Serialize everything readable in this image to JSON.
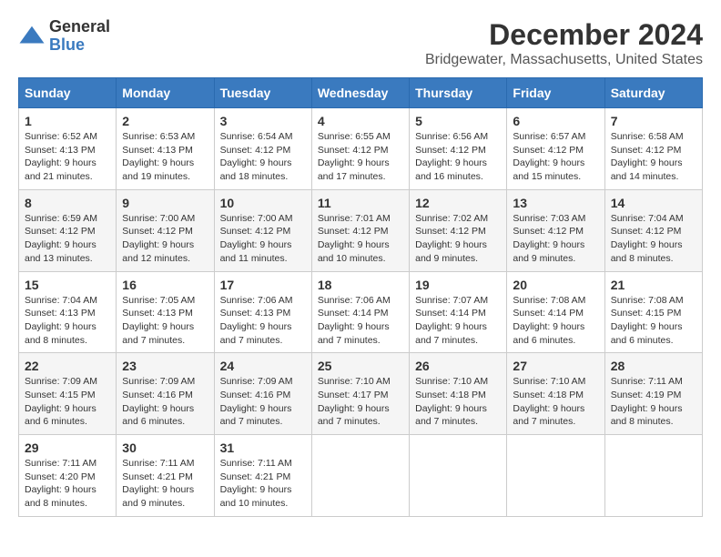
{
  "logo": {
    "general": "General",
    "blue": "Blue"
  },
  "title": "December 2024",
  "subtitle": "Bridgewater, Massachusetts, United States",
  "weekdays": [
    "Sunday",
    "Monday",
    "Tuesday",
    "Wednesday",
    "Thursday",
    "Friday",
    "Saturday"
  ],
  "weeks": [
    [
      {
        "day": "1",
        "sunrise": "6:52 AM",
        "sunset": "4:13 PM",
        "daylight": "9 hours and 21 minutes."
      },
      {
        "day": "2",
        "sunrise": "6:53 AM",
        "sunset": "4:13 PM",
        "daylight": "9 hours and 19 minutes."
      },
      {
        "day": "3",
        "sunrise": "6:54 AM",
        "sunset": "4:12 PM",
        "daylight": "9 hours and 18 minutes."
      },
      {
        "day": "4",
        "sunrise": "6:55 AM",
        "sunset": "4:12 PM",
        "daylight": "9 hours and 17 minutes."
      },
      {
        "day": "5",
        "sunrise": "6:56 AM",
        "sunset": "4:12 PM",
        "daylight": "9 hours and 16 minutes."
      },
      {
        "day": "6",
        "sunrise": "6:57 AM",
        "sunset": "4:12 PM",
        "daylight": "9 hours and 15 minutes."
      },
      {
        "day": "7",
        "sunrise": "6:58 AM",
        "sunset": "4:12 PM",
        "daylight": "9 hours and 14 minutes."
      }
    ],
    [
      {
        "day": "8",
        "sunrise": "6:59 AM",
        "sunset": "4:12 PM",
        "daylight": "9 hours and 13 minutes."
      },
      {
        "day": "9",
        "sunrise": "7:00 AM",
        "sunset": "4:12 PM",
        "daylight": "9 hours and 12 minutes."
      },
      {
        "day": "10",
        "sunrise": "7:00 AM",
        "sunset": "4:12 PM",
        "daylight": "9 hours and 11 minutes."
      },
      {
        "day": "11",
        "sunrise": "7:01 AM",
        "sunset": "4:12 PM",
        "daylight": "9 hours and 10 minutes."
      },
      {
        "day": "12",
        "sunrise": "7:02 AM",
        "sunset": "4:12 PM",
        "daylight": "9 hours and 9 minutes."
      },
      {
        "day": "13",
        "sunrise": "7:03 AM",
        "sunset": "4:12 PM",
        "daylight": "9 hours and 9 minutes."
      },
      {
        "day": "14",
        "sunrise": "7:04 AM",
        "sunset": "4:12 PM",
        "daylight": "9 hours and 8 minutes."
      }
    ],
    [
      {
        "day": "15",
        "sunrise": "7:04 AM",
        "sunset": "4:13 PM",
        "daylight": "9 hours and 8 minutes."
      },
      {
        "day": "16",
        "sunrise": "7:05 AM",
        "sunset": "4:13 PM",
        "daylight": "9 hours and 7 minutes."
      },
      {
        "day": "17",
        "sunrise": "7:06 AM",
        "sunset": "4:13 PM",
        "daylight": "9 hours and 7 minutes."
      },
      {
        "day": "18",
        "sunrise": "7:06 AM",
        "sunset": "4:14 PM",
        "daylight": "9 hours and 7 minutes."
      },
      {
        "day": "19",
        "sunrise": "7:07 AM",
        "sunset": "4:14 PM",
        "daylight": "9 hours and 7 minutes."
      },
      {
        "day": "20",
        "sunrise": "7:08 AM",
        "sunset": "4:14 PM",
        "daylight": "9 hours and 6 minutes."
      },
      {
        "day": "21",
        "sunrise": "7:08 AM",
        "sunset": "4:15 PM",
        "daylight": "9 hours and 6 minutes."
      }
    ],
    [
      {
        "day": "22",
        "sunrise": "7:09 AM",
        "sunset": "4:15 PM",
        "daylight": "9 hours and 6 minutes."
      },
      {
        "day": "23",
        "sunrise": "7:09 AM",
        "sunset": "4:16 PM",
        "daylight": "9 hours and 6 minutes."
      },
      {
        "day": "24",
        "sunrise": "7:09 AM",
        "sunset": "4:16 PM",
        "daylight": "9 hours and 7 minutes."
      },
      {
        "day": "25",
        "sunrise": "7:10 AM",
        "sunset": "4:17 PM",
        "daylight": "9 hours and 7 minutes."
      },
      {
        "day": "26",
        "sunrise": "7:10 AM",
        "sunset": "4:18 PM",
        "daylight": "9 hours and 7 minutes."
      },
      {
        "day": "27",
        "sunrise": "7:10 AM",
        "sunset": "4:18 PM",
        "daylight": "9 hours and 7 minutes."
      },
      {
        "day": "28",
        "sunrise": "7:11 AM",
        "sunset": "4:19 PM",
        "daylight": "9 hours and 8 minutes."
      }
    ],
    [
      {
        "day": "29",
        "sunrise": "7:11 AM",
        "sunset": "4:20 PM",
        "daylight": "9 hours and 8 minutes."
      },
      {
        "day": "30",
        "sunrise": "7:11 AM",
        "sunset": "4:21 PM",
        "daylight": "9 hours and 9 minutes."
      },
      {
        "day": "31",
        "sunrise": "7:11 AM",
        "sunset": "4:21 PM",
        "daylight": "9 hours and 10 minutes."
      },
      null,
      null,
      null,
      null
    ]
  ],
  "labels": {
    "sunrise": "Sunrise:",
    "sunset": "Sunset:",
    "daylight": "Daylight:"
  }
}
